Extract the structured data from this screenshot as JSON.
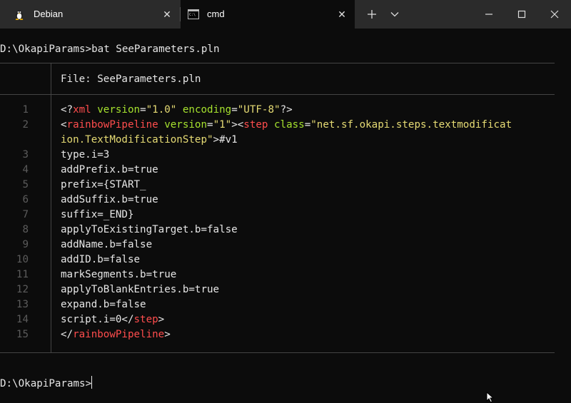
{
  "tabs": [
    {
      "label": "Debian",
      "icon": "linux-penguin-icon",
      "active": false
    },
    {
      "label": "cmd",
      "icon": "cmd-console-icon",
      "active": true
    }
  ],
  "titlebar": {
    "new_tab_icon": "plus-icon",
    "dropdown_icon": "chevron-down-icon"
  },
  "window_controls": {
    "minimize": "minimize-icon",
    "maximize": "maximize-icon",
    "close": "close-icon"
  },
  "terminal": {
    "command_line": "D:\\OkapiParams>bat SeeParameters.pln",
    "file_header": "File: SeeParameters.pln",
    "line_numbers": [
      "1",
      "2",
      "",
      "3",
      "4",
      "5",
      "6",
      "7",
      "8",
      "9",
      "10",
      "11",
      "12",
      "13",
      "14",
      "15"
    ],
    "plain_lines": {
      "l3": "type.i=3",
      "l4": "addPrefix.b=true",
      "l5": "prefix={START_",
      "l6": "addSuffix.b=true",
      "l7": "suffix=_END}",
      "l8": "applyToExistingTarget.b=false",
      "l9": "addName.b=false",
      "l10": "addID.b=false",
      "l11": "markSegments.b=true",
      "l12": "applyToBlankEntries.b=true",
      "l13": "expand.b=false"
    },
    "xml_decl": {
      "open": "<?",
      "tag": "xml",
      "attr1": "version",
      "eq1": "=",
      "val1": "\"1.0\"",
      "attr2": "encoding",
      "eq2": "=",
      "val2": "\"UTF-8\"",
      "close": "?>"
    },
    "line2": {
      "lt1": "<",
      "tag1": "rainbowPipeline",
      "attr1": "version",
      "eq1": "=",
      "val1": "\"1\"",
      "gt1": ">",
      "lt2": "<",
      "tag2": "step",
      "attr2": "class",
      "eq2": "=",
      "val2a": "\"net.sf.okapi.steps.textmodificat",
      "val2b": "ion.TextModificationStep\"",
      "rest": ">#v1"
    },
    "line14": {
      "text": "script.i=0</",
      "tag": "step",
      "gt": ">"
    },
    "line15": {
      "lt": "</",
      "tag": "rainbowPipeline",
      "gt": ">"
    },
    "prompt": "D:\\OkapiParams>"
  },
  "colors": {
    "background": "#0c0c0c",
    "tag": "#ff4d4d",
    "attr": "#a6e22e",
    "value": "#e6db74"
  }
}
